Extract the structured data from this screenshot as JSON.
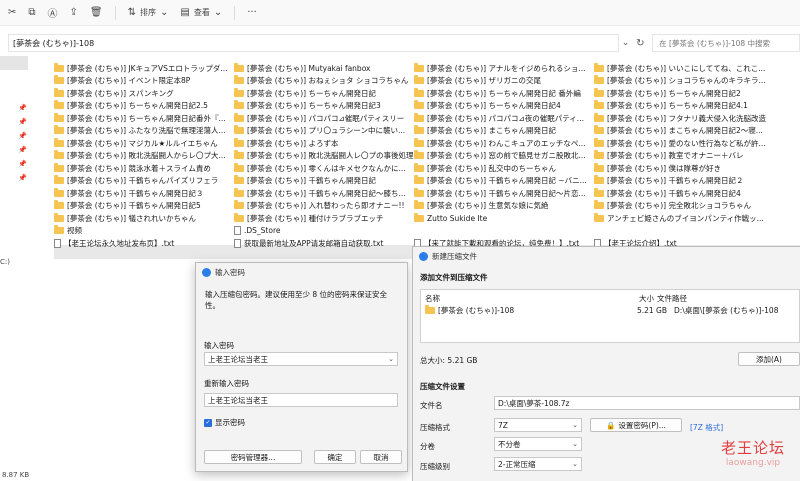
{
  "toolbar": {
    "sort_label": "排序",
    "view_label": "查看",
    "more_label": "···"
  },
  "address": {
    "path": "[夢茶会 (むちゃ)]-108",
    "search_placeholder": "在 [夢茶会 (むちゃ)]-108 中搜索"
  },
  "sidebar": {
    "drive_label": "C:)"
  },
  "files": {
    "col1": [
      "[夢茶会 (むちゃ)] JKキュアVSエロトラップダ...",
      "[夢茶会 (むちゃ)] イベント限定本8P",
      "[夢茶会 (むちゃ)] スパンキング",
      "[夢茶会 (むちゃ)] ちーちゃん開発日記2.5",
      "[夢茶会 (むちゃ)] ちーちゃん開発日記番外『...",
      "[夢茶会 (むちゃ)] ふたなり洗脳で無理淫蕩人...",
      "[夢茶会 (むちゃ)] マジカル★ルルイエちゃん",
      "[夢茶会 (むちゃ)] 敗北洗脳闘人からレ〇プ大...",
      "[夢茶会 (むちゃ)] 競泳水着＋スライム責め",
      "[夢茶会 (むちゃ)] 千鶴ちゃんパイズリフェラ",
      "[夢茶会 (むちゃ)] 千鶴ちゃん開発日記３",
      "[夢茶会 (むちゃ)] 千鶴ちゃん開発日記5",
      "[夢茶会 (むちゃ)] 犠されれいかちゃん",
      "视频",
      "【老王论坛永久地址发布页】.txt"
    ],
    "col2": [
      "[夢茶会 (むちゃ)] Mutyakai fanbox",
      "[夢茶会 (むちゃ)] おねぇショタ ショコラちゃん",
      "[夢茶会 (むちゃ)] ちーちゃん開発日記",
      "[夢茶会 (むちゃ)] ちーちゃん開発日記3",
      "[夢茶会 (むちゃ)] パコパコ⊿催眠パティスリー",
      "[夢茶会 (むちゃ)] プリ〇ュラシーン中に襲い...",
      "[夢茶会 (むちゃ)] よろず本",
      "[夢茶会 (むちゃ)] 敗北洗脳闘人レ〇プの事後処理",
      "[夢茶会 (むちゃ)] 零くんはキメセクなんかに...",
      "[夢茶会 (むちゃ)] 千鶴ちゃん開発日記",
      "[夢茶会 (むちゃ)] 千鶴ちゃん開発日記～膝ち...",
      "[夢茶会 (むちゃ)] 入れ替わったら即オナニー!!",
      "[夢茶会 (むちゃ)] 種付けラブラブエッチ",
      ".DS_Store",
      "获取最新地址及APP请发邮箱自动获取.txt"
    ],
    "col3": [
      "[夢茶会 (むちゃ)] アナルをイジめられるショ...",
      "[夢茶会 (むちゃ)] ザリガニの交尾",
      "[夢茶会 (むちゃ)] ちーちゃん開発日記 番外編",
      "[夢茶会 (むちゃ)] ちーちゃん開発日記4",
      "[夢茶会 (むちゃ)] パコパコ⊿夜の催眠パティ...",
      "[夢茶会 (むちゃ)] まこちゃん開発日記",
      "[夢茶会 (むちゃ)] わんこキュアのエッチなペ...",
      "[夢茶会 (むちゃ)] 窓の前で脇見せガニ股敗北...",
      "[夢茶会 (むちゃ)] 乱交中のちーちゃん",
      "[夢茶会 (むちゃ)] 千鶴ちゃん開発日記 ~バニ...",
      "[夢茶会 (むちゃ)] 千鶴ちゃん開発日記～片恋...",
      "[夢茶会 (むちゃ)] 生意気な娘に気絶",
      "Zutto Sukide Ite",
      "",
      "【来了就能下載和观看的论坛，纯免费！】.txt"
    ],
    "col4": [
      "[夢茶会 (むちゃ)] いいこにしててね、これこ...",
      "[夢茶会 (むちゃ)] ショコラちゃんのキラキラ...",
      "[夢茶会 (むちゃ)] ちーちゃん開発日記2",
      "[夢茶会 (むちゃ)] ちーちゃん開発日記4.1",
      "[夢茶会 (むちゃ)] フタナリ義犬侵入化洗脳改造",
      "[夢茶会 (むちゃ)] まこちゃん開発日記2～寝...",
      "[夢茶会 (むちゃ)] 愛のない性行為など私が許...",
      "[夢茶会 (むちゃ)] 教室でオナニー＋バレ",
      "[夢茶会 (むちゃ)] 僕は隊尊が好き",
      "[夢茶会 (むちゃ)] 千鶴ちゃん開発日記２",
      "[夢茶会 (むちゃ)] 千鶴ちゃん開発日記4",
      "[夢茶会 (むちゃ)] 完全敗北ショコラちゃん",
      "アンチェビ姫さんのブイヨンパンティ作戦ッ...",
      "",
      "【老王论坛介绍】.txt"
    ]
  },
  "password_dialog": {
    "title": "输入密码",
    "message": "输入压缩包密码。建议使用至少 8 位的密码来保证安全性。",
    "enter_label": "输入密码",
    "enter_value": "上老王论坛当老王",
    "reenter_label": "重新输入密码",
    "reenter_value": "上老王论坛当老王",
    "show_password": "显示密码",
    "manager_button": "密码管理器...",
    "ok_button": "确定",
    "cancel_button": "取消"
  },
  "compress_dialog": {
    "title": "新建压缩文件",
    "add_section": "添加文件到压缩文件",
    "col_name": "名称",
    "col_size": "大小",
    "col_path": "文件路径",
    "row_name": "[夢茶会 (むちゃ)]-108",
    "row_size": "5.21 GB",
    "row_path": "D:\\桌面\\[夢茶会 (むちゃ)]-108",
    "total_size": "总大小: 5.21 GB",
    "add_button": "添加(A)",
    "settings_section": "压缩文件设置",
    "filename_label": "文件名",
    "filename_value": "D:\\桌面\\夢茶-108.7z",
    "format_label": "压缩格式",
    "format_value": "7Z",
    "set_password_button": "设置密码(P)...",
    "format_link": "[7Z 格式]",
    "split_label": "分卷",
    "split_value": "不分卷",
    "level_label": "压缩级别",
    "level_value": "2-正常压缩"
  },
  "status": {
    "size_text": "8.87 KB"
  },
  "watermark": {
    "line1": "老王论坛",
    "line2": "laowang.vip"
  }
}
